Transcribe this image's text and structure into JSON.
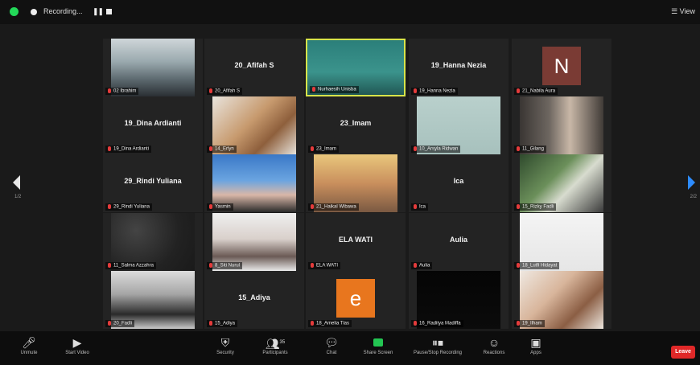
{
  "topbar": {
    "recording_label": "Recording...",
    "view_label": "View"
  },
  "tiles": [
    {
      "name": "",
      "label": "02 Ibrahim",
      "row": 0,
      "col": 0,
      "video": "person-hijab"
    },
    {
      "name": "20_Afifah S",
      "label": "20_Afifah S",
      "row": 0,
      "col": 1
    },
    {
      "name": "",
      "label": "Nurhaesih Unisba",
      "row": 0,
      "col": 2,
      "video": "unisba-speaker",
      "active": true
    },
    {
      "name": "19_Hanna Nezia",
      "label": "19_Hanna Nezia",
      "row": 0,
      "col": 3
    },
    {
      "name": "",
      "label": "21_Nabila Aura",
      "row": 0,
      "col": 4,
      "avatar": "N"
    },
    {
      "name": "19_Dina Ardianti",
      "label": "19_Dina Ardianti",
      "row": 1,
      "col": 0
    },
    {
      "name": "",
      "label": "14_Erlyn",
      "row": 1,
      "col": 1,
      "video": "food"
    },
    {
      "name": "23_Imam",
      "label": "23_Imam",
      "row": 1,
      "col": 2
    },
    {
      "name": "",
      "label": "10_Arsyla Ridwan",
      "row": 1,
      "col": 3,
      "video": "blank"
    },
    {
      "name": "",
      "label": "11_Gilang",
      "row": 1,
      "col": 4,
      "video": "person-room"
    },
    {
      "name": "29_Rindi Yuliana",
      "label": "29_Rindi Yuliana",
      "row": 2,
      "col": 0
    },
    {
      "name": "",
      "label": "Yasmin",
      "row": 2,
      "col": 1,
      "video": "person-blue"
    },
    {
      "name": "",
      "label": "21_Haikal Wibawa",
      "row": 2,
      "col": 2,
      "video": "person-face"
    },
    {
      "name": "Ica",
      "label": "Ica",
      "row": 2,
      "col": 3
    },
    {
      "name": "",
      "label": "15_Rizky Fadli",
      "row": 2,
      "col": 4,
      "video": "plants"
    },
    {
      "name": "",
      "label": "11_Salma Azzahra",
      "row": 3,
      "col": 0,
      "video": "dark"
    },
    {
      "name": "",
      "label": "8_Siti Nurul",
      "row": 3,
      "col": 1,
      "video": "person-light"
    },
    {
      "name": "ELA WATI",
      "label": "ELA WATI",
      "row": 3,
      "col": 2
    },
    {
      "name": "Aulia",
      "label": "Aulia",
      "row": 3,
      "col": 3
    },
    {
      "name": "",
      "label": "18_Lutfi Hidayat",
      "row": 3,
      "col": 4,
      "video": "paper"
    },
    {
      "name": "",
      "label": "20_Fadli",
      "row": 4,
      "col": 0,
      "video": "person-cap"
    },
    {
      "name": "15_Adiya",
      "label": "15_Adiya",
      "row": 4,
      "col": 1
    },
    {
      "name": "",
      "label": "18_Amelia Tias",
      "row": 4,
      "col": 2,
      "avatar": "e"
    },
    {
      "name": "",
      "label": "16_Raditya Madiffa",
      "row": 4,
      "col": 3,
      "video": "black"
    },
    {
      "name": "",
      "label": "19_Ilham",
      "row": 4,
      "col": 4,
      "video": "person-white"
    }
  ],
  "pager": {
    "left": "1/2",
    "right": "2/2"
  },
  "toolbar": {
    "unmute": "Unmute",
    "start_video": "Start Video",
    "security": "Security",
    "participants": "Participants",
    "participants_count": "35",
    "chat": "Chat",
    "share_screen": "Share Screen",
    "pause_recording": "Pause/Stop Recording",
    "reactions": "Reactions",
    "apps": "Apps",
    "end": "Leave"
  },
  "colors": {
    "accent": "#2d8cff",
    "active_border": "#d7e44a",
    "muted": "#e53b3b",
    "share": "#23c552",
    "leave": "#e02828"
  }
}
